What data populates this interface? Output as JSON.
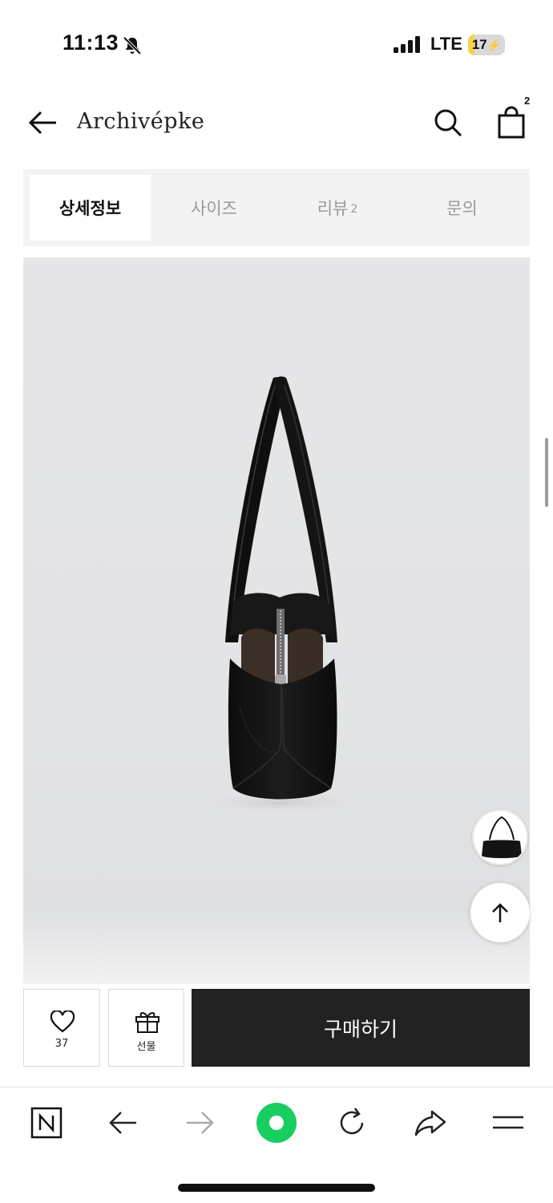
{
  "status_bar": {
    "time": "11:13",
    "network": "LTE",
    "battery": "17",
    "battery_level_percent": 17,
    "icons": [
      "bell-slash-icon",
      "signal-icon",
      "battery-charging-icon"
    ]
  },
  "header": {
    "brand": "Archivépke",
    "cart_count": "2",
    "icons": [
      "arrow-left-icon",
      "search-icon",
      "shopping-bag-icon"
    ]
  },
  "tabs": [
    {
      "label": "상세정보",
      "count": "",
      "active": true
    },
    {
      "label": "사이즈",
      "count": "",
      "active": false
    },
    {
      "label": "리뷰",
      "count": "2",
      "active": false
    },
    {
      "label": "문의",
      "count": "",
      "active": false
    }
  ],
  "actions": {
    "like_count": "37",
    "gift_label": "선물",
    "buy_label": "구매하기",
    "icons": [
      "heart-icon",
      "gift-icon",
      "arrow-up-icon"
    ]
  },
  "browser_toolbar": {
    "icons": [
      "naver-n-icon",
      "back-arrow-icon",
      "forward-arrow-icon",
      "green-circle-icon",
      "refresh-icon",
      "share-icon",
      "menu-icon"
    ]
  },
  "colors": {
    "primary_button": "#222222",
    "tab_background": "#f3f3f3",
    "image_background": "#e4e5e7",
    "browser_accent": "#19ce60",
    "battery_fill": "#f5d547"
  }
}
